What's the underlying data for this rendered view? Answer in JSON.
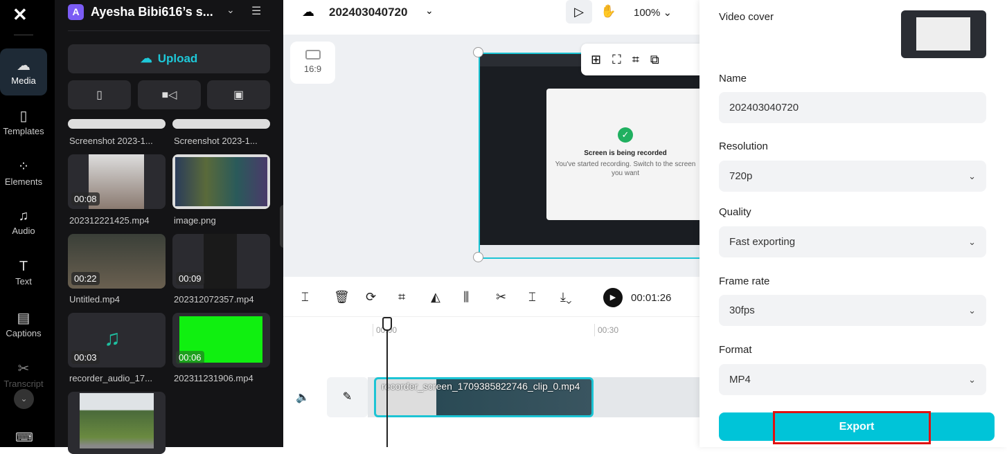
{
  "rail": {
    "items": [
      {
        "label": "Media",
        "icon": "cloud-upload-icon"
      },
      {
        "label": "Templates",
        "icon": "templates-icon"
      },
      {
        "label": "Elements",
        "icon": "elements-icon"
      },
      {
        "label": "Audio",
        "icon": "music-note-icon"
      },
      {
        "label": "Text",
        "icon": "text-icon"
      },
      {
        "label": "Captions",
        "icon": "captions-icon"
      },
      {
        "label": "Transcript",
        "icon": "transcript-icon"
      }
    ]
  },
  "media": {
    "workspace_initial": "A",
    "workspace_name": "Ayesha Bibi616’s s...",
    "upload_label": "Upload",
    "items": [
      {
        "name": "Screenshot 2023-1..."
      },
      {
        "name": "Screenshot 2023-1..."
      },
      {
        "name": "202312221425.mp4",
        "duration": "00:08"
      },
      {
        "name": "image.png"
      },
      {
        "name": "Untitled.mp4",
        "duration": "00:22"
      },
      {
        "name": "202312072357.mp4",
        "duration": "00:09"
      },
      {
        "name": "recorder_audio_17...",
        "duration": "00:03"
      },
      {
        "name": "202311231906.mp4",
        "duration": "00:06"
      },
      {
        "name": ""
      }
    ]
  },
  "topbar": {
    "project_name": "202403040720",
    "zoom": "100%"
  },
  "canvas": {
    "aspect_ratio": "16:9",
    "preview_text": "Screen is being recorded",
    "preview_sub": "You've started recording. Switch to the screen you want"
  },
  "player": {
    "current_time": "00:01:26"
  },
  "timeline": {
    "ticks": [
      "00:00",
      "00:30"
    ],
    "clip_name": "recorder_screen_1709385822746_clip_0.mp4"
  },
  "export": {
    "video_cover_label": "Video cover",
    "name_label": "Name",
    "name_value": "202403040720",
    "resolution_label": "Resolution",
    "resolution_value": "720p",
    "quality_label": "Quality",
    "quality_value": "Fast exporting",
    "framerate_label": "Frame rate",
    "framerate_value": "30fps",
    "format_label": "Format",
    "format_value": "MP4",
    "export_button": "Export",
    "accent": "#00c4d8",
    "highlight": "#e01010"
  }
}
